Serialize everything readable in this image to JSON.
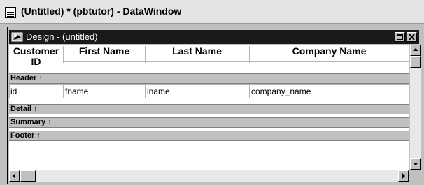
{
  "window": {
    "title": "(Untitled) * (pbtutor) - DataWindow",
    "sys_icon": "document-icon"
  },
  "child": {
    "title": "Design - (untitled)",
    "icon": "datawindow-design-icon"
  },
  "columns": {
    "headers": [
      "Customer ID",
      "First Name",
      "Last Name",
      "Company Name"
    ],
    "header_line1": "Customer",
    "header_line2": "ID",
    "first_name": "First Name",
    "last_name": "Last Name",
    "company_name": "Company Name"
  },
  "fields": {
    "id": "id",
    "fname": "fname",
    "lname": "lname",
    "company_name": "company_name"
  },
  "bands": {
    "header": "Header ↑",
    "detail": "Detail ↑",
    "summary": "Summary ↑",
    "footer": "Footer ↑"
  }
}
